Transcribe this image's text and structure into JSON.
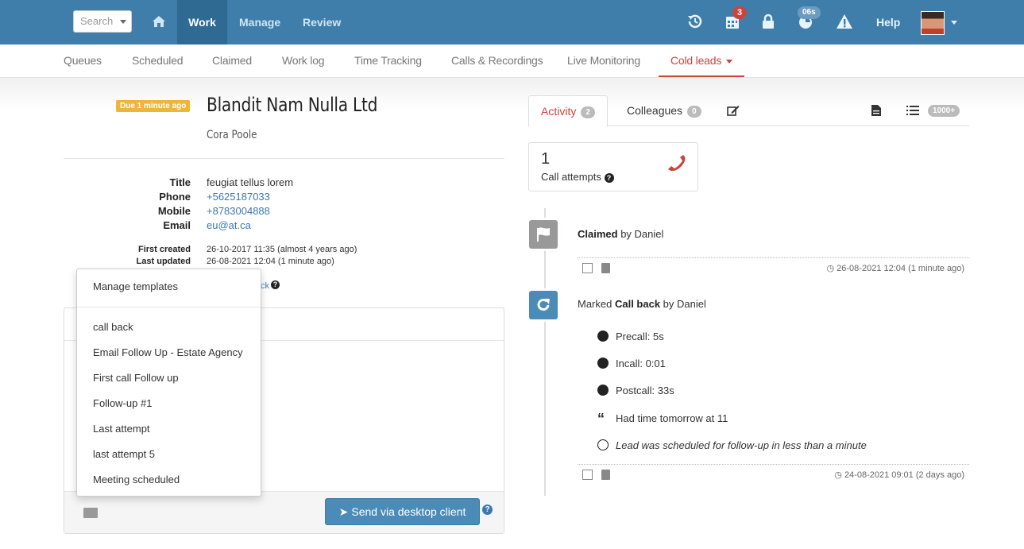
{
  "topnav": {
    "search_placeholder": "Search",
    "items": [
      "Work",
      "Manage",
      "Review"
    ],
    "calendar_badge": "3",
    "timer_badge": "06s",
    "help": "Help"
  },
  "subnav": {
    "items": [
      "Queues",
      "Scheduled",
      "Claimed",
      "Work log",
      "Time Tracking",
      "Calls & Recordings",
      "Live Monitoring"
    ],
    "active": "Cold leads"
  },
  "lead": {
    "due": "Due 1 minute ago",
    "company": "Blandit Nam Nulla Ltd",
    "contact": "Cora Poole",
    "fields": [
      {
        "label": "Title",
        "value": "feugiat tellus lorem"
      },
      {
        "label": "Phone",
        "value": "+5625187033"
      },
      {
        "label": "Mobile",
        "value": "+8783004888"
      },
      {
        "label": "Email",
        "value": "eu@at.ca"
      }
    ],
    "first_created_label": "First created",
    "first_created": "26-10-2017 11:35 (almost 4 years ago)",
    "last_updated_label": "Last updated",
    "last_updated": "26-08-2021 12:04 (1 minute ago)",
    "partial_link": "ck"
  },
  "templates": {
    "manage": "Manage templates",
    "items": [
      "call back",
      "Email Follow Up - Estate Agency",
      "First call Follow up",
      "Follow-up #1",
      "Last attempt",
      "last attempt 5",
      "Meeting scheduled"
    ]
  },
  "composer": {
    "send": "Send via desktop client"
  },
  "right": {
    "tabs": [
      {
        "label": "Activity",
        "count": "2"
      },
      {
        "label": "Colleagues",
        "count": "0"
      }
    ],
    "list_count": "1000+",
    "attempts_num": "1",
    "attempts_label": "Call attempts",
    "claimed_bold": "Claimed",
    "claimed_by": " by Daniel",
    "claimed_time": "26-08-2021 12:04 (1 minute ago)",
    "marked_prefix": "Marked ",
    "marked_bold": "Call back",
    "marked_by": " by Daniel",
    "details": {
      "precall": "Precall: 5s",
      "incall": "Incall: 0:01",
      "postcall": "Postcall: 33s",
      "note": "Had time tomorrow at 11",
      "scheduled": "Lead was scheduled for follow-up in less than a minute"
    },
    "marked_time": "24-08-2021 09:01 (2 days ago)"
  },
  "colors": {
    "topbar": "#3f7eaa",
    "active_nav": "#2f6a93",
    "accent_red": "#c9463d",
    "link_blue": "#3b78b0",
    "due_badge": "#eeb53c"
  }
}
